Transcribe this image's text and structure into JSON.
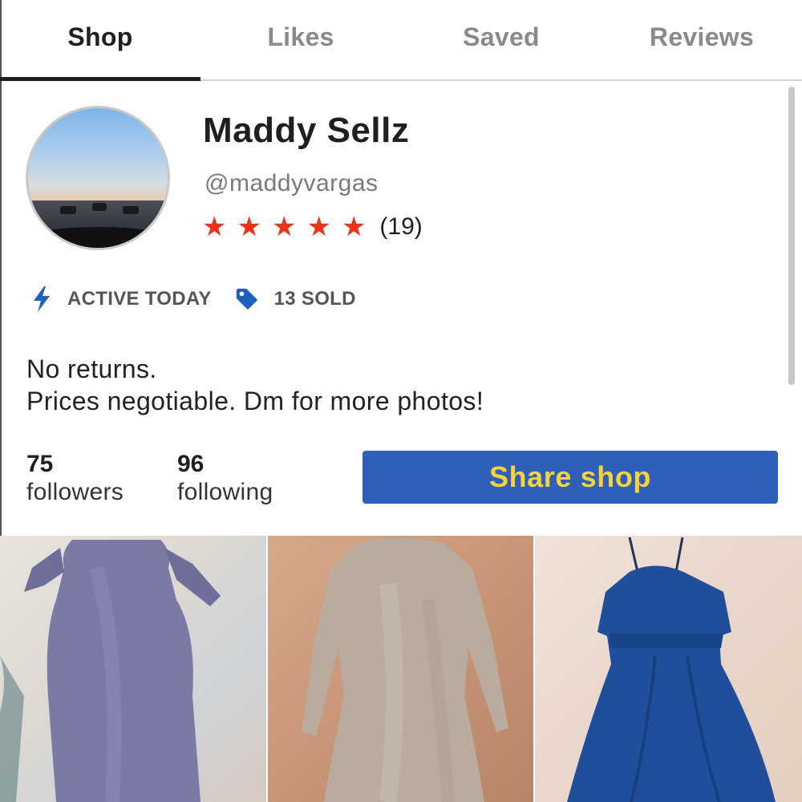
{
  "tabs": [
    {
      "label": "Shop",
      "active": true
    },
    {
      "label": "Likes",
      "active": false
    },
    {
      "label": "Saved",
      "active": false
    },
    {
      "label": "Reviews",
      "active": false
    }
  ],
  "profile": {
    "name": "Maddy Sellz",
    "handle": "@maddyvargas",
    "rating": {
      "stars": 5,
      "count": "(19)"
    },
    "badges": [
      {
        "icon": "lightning-icon",
        "label": "ACTIVE TODAY"
      },
      {
        "icon": "price-tag-icon",
        "label": "13 SOLD"
      }
    ],
    "bio": [
      "No returns.",
      "Prices negotiable. Dm for more photos!"
    ]
  },
  "stats": {
    "followers": {
      "count": "75",
      "label": "followers"
    },
    "following": {
      "count": "96",
      "label": "following"
    }
  },
  "share_button": {
    "label": "Share shop"
  },
  "colors": {
    "star": "#e8341c",
    "badge_icon": "#1f5fbf",
    "button_bg": "#2f5fb8",
    "button_text": "#f6d23b"
  },
  "listings": [
    {
      "item": "lavender long-sleeve dress"
    },
    {
      "item": "silver glitter long-sleeve dress"
    },
    {
      "item": "blue halter dress"
    }
  ]
}
